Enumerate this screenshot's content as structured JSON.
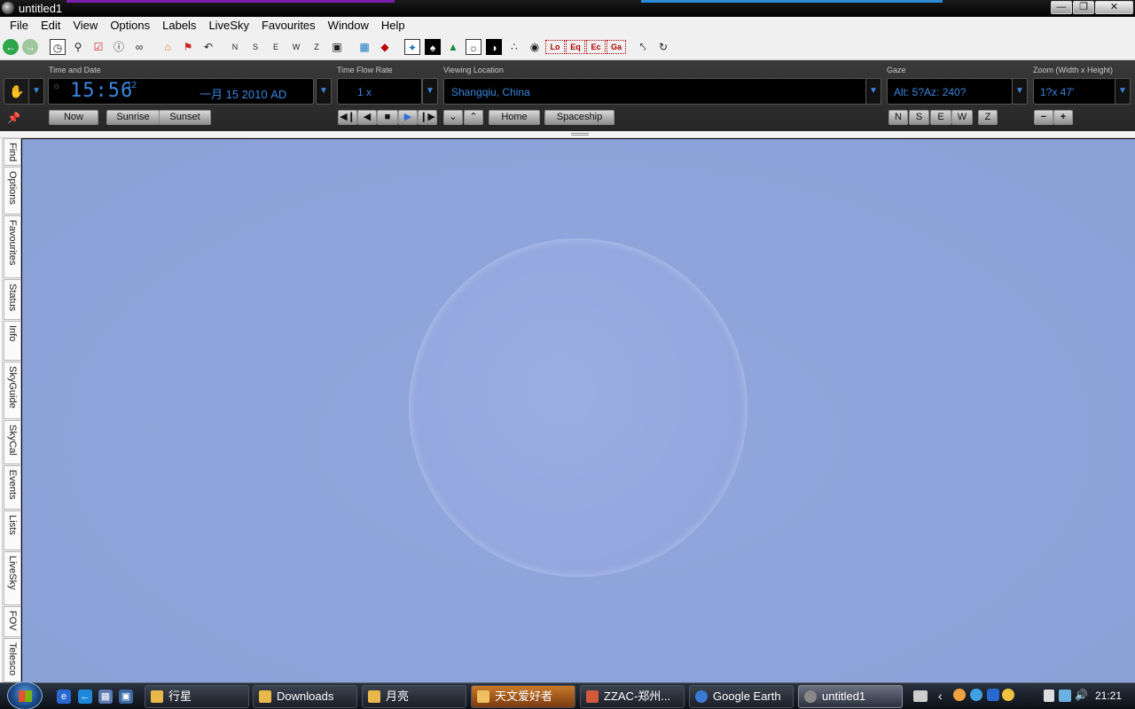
{
  "window": {
    "title": "untitled1",
    "min": "—",
    "max": "❐",
    "close": "✕"
  },
  "menu": [
    "File",
    "Edit",
    "View",
    "Options",
    "Labels",
    "LiveSky",
    "Favourites",
    "Window",
    "Help"
  ],
  "toolbar": {
    "compass": [
      "N",
      "S",
      "E",
      "W",
      "Z"
    ],
    "grid_labels": [
      "Lo",
      "Eq",
      "Ec",
      "Ga"
    ]
  },
  "time": {
    "label": "Time and Date",
    "clock": "15:56",
    "seconds": "12",
    "date": "一月 15   2010 AD",
    "now_button": "Now",
    "sunrise_button": "Sunrise",
    "sunset_button": "Sunset"
  },
  "flow": {
    "label": "Time Flow Rate",
    "rate": "1 x"
  },
  "location": {
    "label": "Viewing Location",
    "value": "Shangqiu, China",
    "home_button": "Home",
    "spaceship_button": "Spaceship"
  },
  "gaze": {
    "label": "Gaze",
    "value": "Alt: 5?Az: 240?",
    "buttons": [
      "N",
      "S",
      "E",
      "W",
      "Z"
    ]
  },
  "zoom": {
    "label": "Zoom (Width x Height)",
    "value": "1?x 47'",
    "minus": "−",
    "plus": "+"
  },
  "side_tabs": [
    "Find",
    "Options",
    "Favourites",
    "Status",
    "Info",
    "SkyGuide",
    "SkyCal",
    "Events",
    "Lists",
    "LiveSky",
    "FOV",
    "Telesco"
  ],
  "taskbar": {
    "tasks": [
      "行星",
      "Downloads",
      "月亮",
      "天文爱好者",
      "ZZAC-郑州...",
      "Google Earth",
      "untitled1"
    ],
    "clock": "21:21"
  },
  "colors": {
    "sky": "#8ea4da",
    "lcd_text": "#3a86e0",
    "panel": "#2f2f2f"
  }
}
